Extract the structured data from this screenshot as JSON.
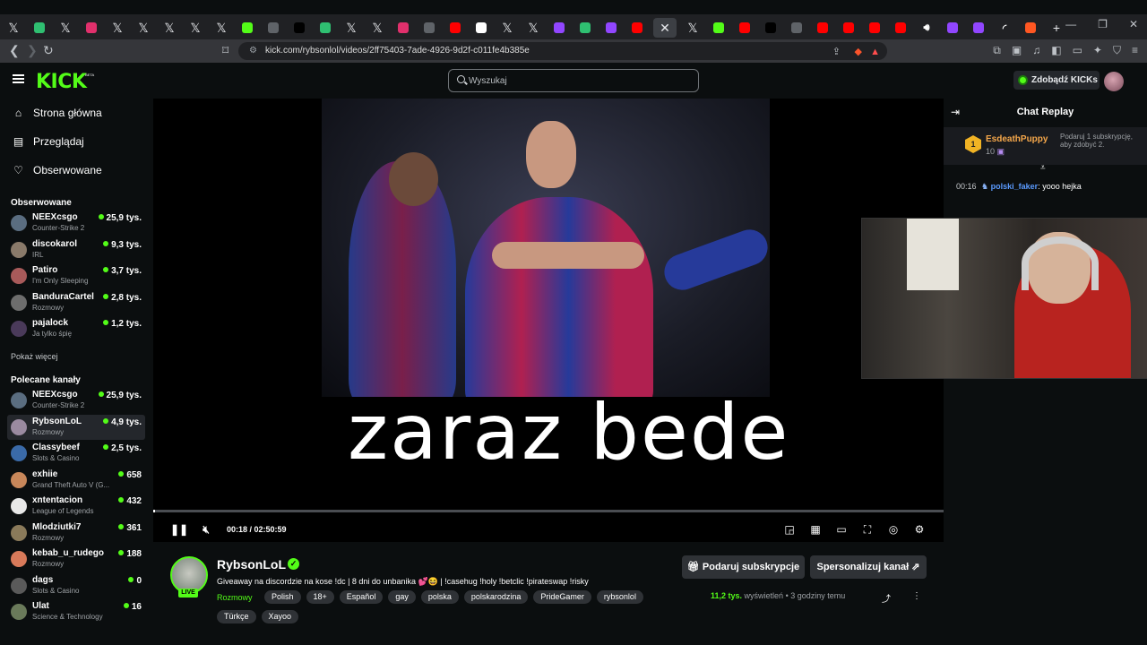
{
  "browser": {
    "url": "kick.com/rybsonlol/videos/2ff75403-7ade-4926-9d2f-c011fe4b385e",
    "tabs": [
      {
        "icon": "x-icon",
        "color": "#000000"
      },
      {
        "icon": "ext-icon",
        "color": "#2fbf71"
      },
      {
        "icon": "x-icon",
        "color": "#000000"
      },
      {
        "icon": "instagram-icon",
        "color": "#e1306c"
      },
      {
        "icon": "x-icon",
        "color": "#000000"
      },
      {
        "icon": "x-icon",
        "color": "#000000"
      },
      {
        "icon": "x-icon",
        "color": "#000000"
      },
      {
        "icon": "x-icon",
        "color": "#000000"
      },
      {
        "icon": "x-icon",
        "color": "#000000"
      },
      {
        "icon": "kick-icon",
        "color": "#53fc18"
      },
      {
        "icon": "blank-icon",
        "color": "#5f6368"
      },
      {
        "icon": "tiktok-icon",
        "color": "#000000"
      },
      {
        "icon": "ext-icon",
        "color": "#2fbf71"
      },
      {
        "icon": "x-icon",
        "color": "#000000"
      },
      {
        "icon": "x-icon",
        "color": "#000000"
      },
      {
        "icon": "instagram-icon",
        "color": "#e1306c"
      },
      {
        "icon": "globe-icon",
        "color": "#5f6368"
      },
      {
        "icon": "youtube-icon",
        "color": "#ff0000"
      },
      {
        "icon": "google-icon",
        "color": "#ffffff"
      },
      {
        "icon": "x-icon",
        "color": "#000000"
      },
      {
        "icon": "x-icon",
        "color": "#000000"
      },
      {
        "icon": "twitch-icon",
        "color": "#9146ff"
      },
      {
        "icon": "ext-icon",
        "color": "#2fbf71"
      },
      {
        "icon": "twitch-icon",
        "color": "#9146ff"
      },
      {
        "icon": "youtube-icon",
        "color": "#ff0000"
      },
      {
        "icon": "close-icon",
        "color": "#3c3f44"
      },
      {
        "icon": "x-icon",
        "color": "#000000"
      },
      {
        "icon": "kick-icon",
        "color": "#53fc18"
      },
      {
        "icon": "youtube-icon",
        "color": "#ff0000"
      },
      {
        "icon": "tiktok-icon",
        "color": "#000000"
      },
      {
        "icon": "globe-icon",
        "color": "#5f6368"
      },
      {
        "icon": "youtube-icon",
        "color": "#ff0000"
      },
      {
        "icon": "youtube-icon",
        "color": "#ff0000"
      },
      {
        "icon": "youtube-icon",
        "color": "#ff0000"
      },
      {
        "icon": "youtube-icon",
        "color": "#ff0000"
      },
      {
        "icon": "speaker-icon",
        "color": "#5f6368"
      },
      {
        "icon": "twitch-icon",
        "color": "#9146ff"
      },
      {
        "icon": "twitch-icon",
        "color": "#9146ff"
      },
      {
        "icon": "loading-icon",
        "color": "#ff0000"
      },
      {
        "icon": "chart-icon",
        "color": "#ff5722"
      }
    ],
    "new_tab_label": "+"
  },
  "header": {
    "logo": "KICK",
    "logo_badge": "BETA",
    "search_placeholder": "Wyszukaj",
    "get_kicks_label": "Zdobądź KICKs"
  },
  "sidebar": {
    "nav": [
      {
        "label": "Strona główna",
        "icon": "home-icon"
      },
      {
        "label": "Przeglądaj",
        "icon": "browse-icon"
      },
      {
        "label": "Obserwowane",
        "icon": "heart-icon"
      }
    ],
    "followed_title": "Obserwowane",
    "followed": [
      {
        "name": "NEEXcsgo",
        "category": "Counter-Strike 2",
        "viewers": "25,9 tys.",
        "color": "#5a6d80"
      },
      {
        "name": "discokarol",
        "category": "IRL",
        "viewers": "9,3 tys.",
        "color": "#8a7a6a"
      },
      {
        "name": "Patiro",
        "category": "I'm Only Sleeping",
        "viewers": "3,7 tys.",
        "color": "#a85a5a"
      },
      {
        "name": "BanduraCartel",
        "category": "Rozmowy",
        "viewers": "2,8 tys.",
        "color": "#6d6d6d"
      },
      {
        "name": "pajalock",
        "category": "Ja tylko śpię",
        "viewers": "1,2 tys.",
        "color": "#4a3a5a"
      }
    ],
    "show_more": "Pokaż więcej",
    "recommended_title": "Polecane kanały",
    "recommended": [
      {
        "name": "NEEXcsgo",
        "category": "Counter-Strike 2",
        "viewers": "25,9 tys.",
        "color": "#5a6d80"
      },
      {
        "name": "RybsonLoL",
        "category": "Rozmowy",
        "viewers": "4,9 tys.",
        "color": "#9a8aa0"
      },
      {
        "name": "Classybeef",
        "category": "Slots & Casino",
        "viewers": "2,5 tys.",
        "color": "#3a6aa8"
      },
      {
        "name": "exhiie",
        "category": "Grand Theft Auto V (G...",
        "viewers": "658",
        "color": "#c8875a"
      },
      {
        "name": "xntentacion",
        "category": "League of Legends",
        "viewers": "432",
        "color": "#e8e8e8"
      },
      {
        "name": "Mlodziutki7",
        "category": "Rozmowy",
        "viewers": "361",
        "color": "#8a7a5a"
      },
      {
        "name": "kebab_u_rudego",
        "category": "Rozmowy",
        "viewers": "188",
        "color": "#d87a5a"
      },
      {
        "name": "dags",
        "category": "Slots & Casino",
        "viewers": "0",
        "color": "#5a5a5a"
      },
      {
        "name": "Ulat",
        "category": "Science & Technology",
        "viewers": "16",
        "color": "#6a7a5a"
      }
    ]
  },
  "player": {
    "caption": "zaraz bede",
    "time": "00:18 / 02:50:59",
    "progress": 0.0018
  },
  "chat": {
    "title": "Chat Replay",
    "gift": {
      "rank": "1",
      "user": "EsdeathPuppy",
      "count": "10",
      "text": "Podaruj 1 subskrypcję, aby zdobyć 2."
    },
    "message": {
      "time": "00:16",
      "user": "polski_faker",
      "text": "yooo hejka"
    }
  },
  "stream": {
    "name": "RybsonLoL",
    "live": "LIVE",
    "title": "Giveaway na discordzie na kose !dc | 8 dni do unbanika 💕😆 | !casehug !holy !betclic !pirateswap !risky",
    "category": "Rozmowy",
    "tags": [
      "Polish",
      "18+",
      "Español",
      "gay",
      "polska",
      "polskarodzina",
      "PrideGamer",
      "rybsonlol"
    ],
    "tags_row2": [
      "Türkçe",
      "Xayoo"
    ],
    "gift_sub_label": "Podaruj subskrypcje",
    "personalize_label": "Spersonalizuj kanał",
    "views": "11,2 tys.",
    "views_label": "wyświetleń",
    "ago": "3 godziny temu"
  }
}
